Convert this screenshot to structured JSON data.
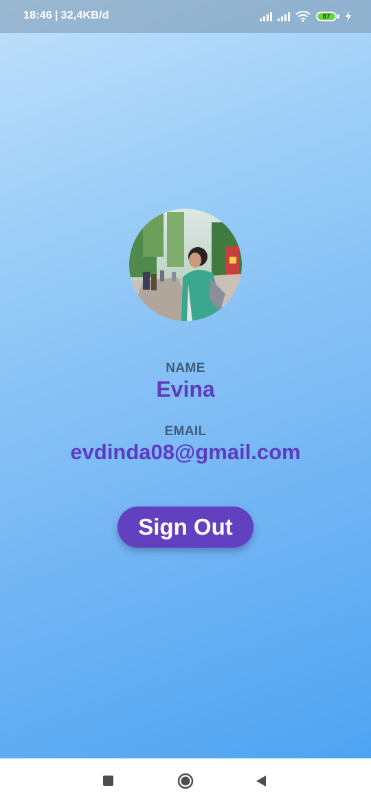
{
  "status_bar": {
    "time": "18:46",
    "separator": "|",
    "network_speed": "32,4KB/d",
    "battery_level": "87"
  },
  "profile": {
    "avatar_description": "profile photo",
    "name_label": "NAME",
    "name_value": "Evina",
    "email_label": "EMAIL",
    "email_value": "evdinda08@gmail.com"
  },
  "actions": {
    "sign_out_label": "Sign Out"
  },
  "navigation": {
    "recents_icon": "square-icon",
    "home_icon": "circle-home-icon",
    "back_icon": "triangle-back-icon"
  },
  "colors": {
    "gradient_top": "#c0e0fb",
    "gradient_bottom": "#4ea4f2",
    "accent_text": "#5c3cc0",
    "button": "#6340c0",
    "label_text": "#3f5d78"
  }
}
